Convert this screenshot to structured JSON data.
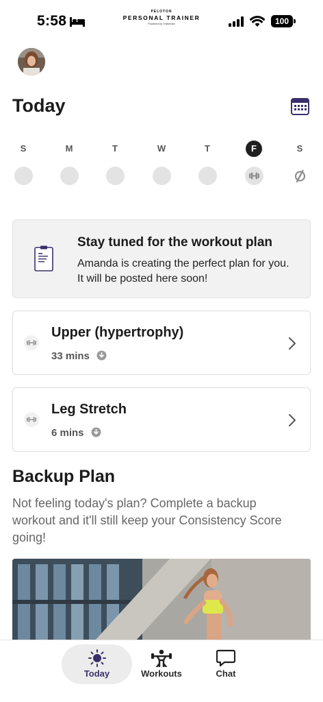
{
  "status_bar": {
    "time": "5:58",
    "battery": "100",
    "brand": {
      "top": "PELOTON",
      "main": "PERSONAL TRAINER",
      "sub": "Powered by Trainerize"
    }
  },
  "header": {
    "title": "Today",
    "calendar_icon": "calendar-icon"
  },
  "week": {
    "days": [
      {
        "letter": "S",
        "active": false,
        "marker": "empty"
      },
      {
        "letter": "M",
        "active": false,
        "marker": "empty"
      },
      {
        "letter": "T",
        "active": false,
        "marker": "empty"
      },
      {
        "letter": "W",
        "active": false,
        "marker": "empty"
      },
      {
        "letter": "T",
        "active": false,
        "marker": "empty"
      },
      {
        "letter": "F",
        "active": true,
        "marker": "dumbbell-icon"
      },
      {
        "letter": "S",
        "active": false,
        "marker": "peloton-logo-icon"
      }
    ]
  },
  "info_card": {
    "icon": "clipboard-icon",
    "title": "Stay tuned for the workout plan",
    "body": "Amanda is creating the perfect plan for you. It will be posted here soon!"
  },
  "workouts": [
    {
      "title": "Upper (hypertrophy)",
      "duration": "33 mins",
      "icon": "dumbbell-icon"
    },
    {
      "title": "Leg Stretch",
      "duration": "6 mins",
      "icon": "dumbbell-icon"
    }
  ],
  "backup": {
    "title": "Backup Plan",
    "body": "Not feeling today's plan? Complete a backup workout and it'll still keep your Consistency Score going!"
  },
  "tabs": [
    {
      "label": "Today",
      "icon": "sun-icon",
      "active": true
    },
    {
      "label": "Workouts",
      "icon": "weightlifter-icon",
      "active": false
    },
    {
      "label": "Chat",
      "icon": "chat-bubble-icon",
      "active": false
    }
  ],
  "colors": {
    "accent": "#3a2f6b",
    "card_bg": "#f2f2f2",
    "text": "#1b1b1b",
    "muted": "#666666"
  }
}
